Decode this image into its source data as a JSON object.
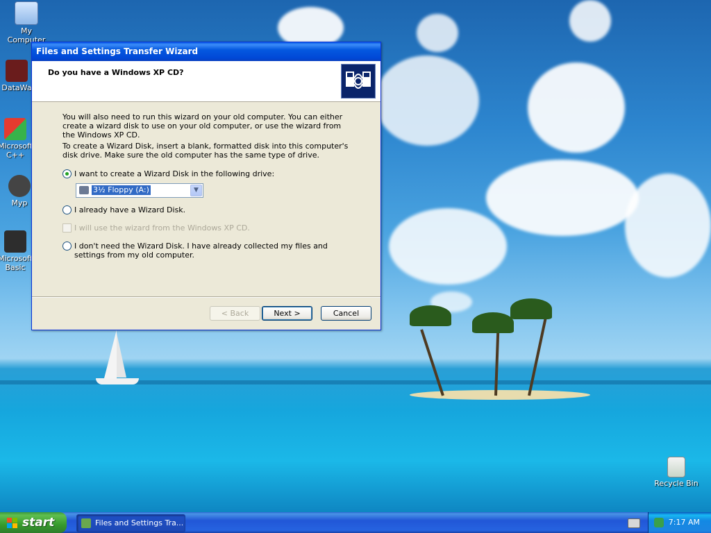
{
  "desktop": {
    "icons": [
      {
        "label": "My Computer"
      },
      {
        "label": "DataWa"
      },
      {
        "label": "Microsoft C++"
      },
      {
        "label": "Myp"
      },
      {
        "label": "Microsoft Basic"
      },
      {
        "label": "Recycle Bin"
      }
    ]
  },
  "dialog": {
    "title": "Files and Settings Transfer Wizard",
    "header_title": "Do you have a Windows XP CD?",
    "para1": "You will also need to run this wizard on your old computer. You can either create a wizard disk to use on your old computer, or use the wizard from the Windows XP CD.",
    "para2": "To create a Wizard Disk, insert a blank, formatted disk into this computer's disk drive. Make sure the old computer has the same type of drive.",
    "option1": "I want to create a Wizard Disk in the following drive:",
    "drive_select": "3½ Floppy (A:)",
    "option2": "I already have a Wizard Disk.",
    "option3": "I will use the wizard from the Windows XP CD.",
    "option4": "I don't need the Wizard Disk. I have already collected my files and settings from my old computer.",
    "buttons": {
      "back": "< Back",
      "next": "Next >",
      "cancel": "Cancel"
    }
  },
  "taskbar": {
    "start_label": "start",
    "task_button": "Files and Settings Tra...",
    "clock": "7:17 AM"
  },
  "icons": [
    "my-computer-icon",
    "recycle-bin-icon",
    "wizard-header-icon",
    "floppy-drive-icon",
    "windows-flag-icon",
    "keyboard-icon",
    "network-tray-icon"
  ]
}
